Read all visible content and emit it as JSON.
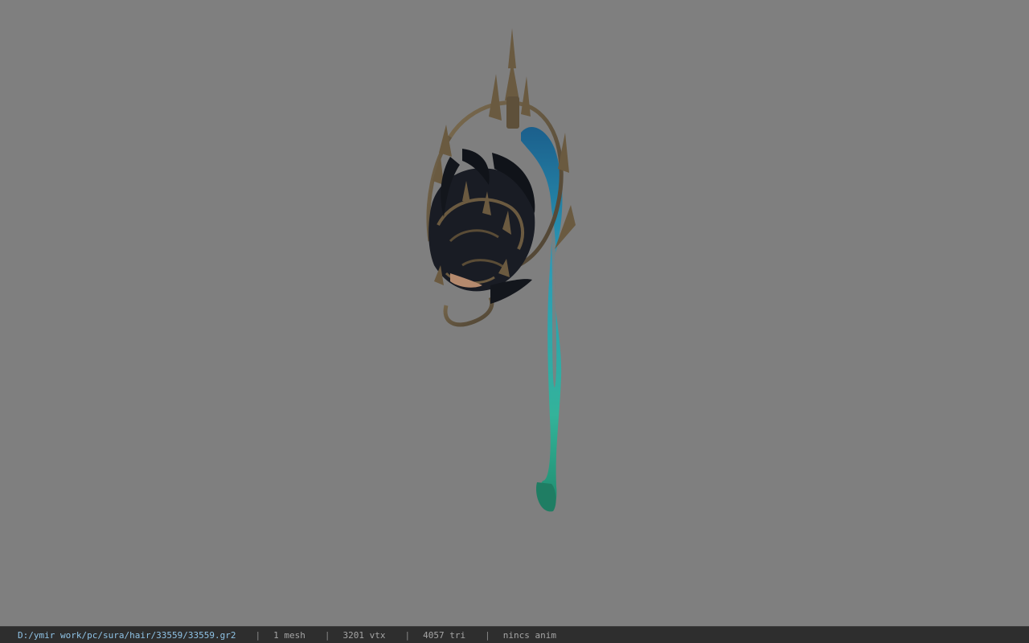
{
  "status_bar": {
    "file_path": "D:/ymir work/pc/sura/hair/33559/33559.gr2",
    "separator": "|",
    "mesh_count": "1 mesh",
    "vertex_count": "3201 vtx",
    "triangle_count": "4057 tri",
    "animation": "nincs anim"
  },
  "colors": {
    "viewport_background": "#7f7f7f",
    "status_background": "#2e2e2e",
    "path_text": "#8fc3e6",
    "model_metal": "#6e5e44",
    "model_dark": "#14171e",
    "ribbon_top": "#1a6f9a",
    "ribbon_bottom": "#2fa98f"
  }
}
